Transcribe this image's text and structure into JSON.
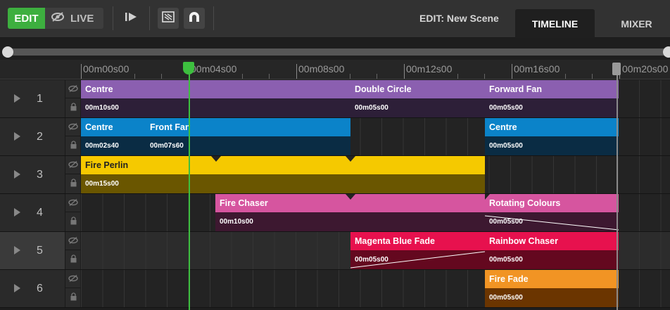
{
  "toolbar": {
    "edit_label": "EDIT",
    "live_label": "LIVE",
    "scene_label": "EDIT: New Scene",
    "tabs": {
      "timeline": "TIMELINE",
      "mixer": "MIXER"
    },
    "icons": [
      "hide-icon",
      "play-icon",
      "fill-frame-icon",
      "magnet-icon"
    ]
  },
  "ruler": {
    "labels": [
      "00m00s00",
      "00m04s00",
      "00m08s00",
      "00m12s00",
      "00m16s00",
      "00m20s00"
    ]
  },
  "tracks": [
    {
      "number": "1",
      "clips": [
        {
          "name": "Centre",
          "duration": "00m10s00",
          "color": "#8b5fb0"
        },
        {
          "name": "Double Circle",
          "duration": "00m05s00",
          "color": "#8b5fb0"
        },
        {
          "name": "Forward Fan",
          "duration": "00m05s00",
          "color": "#8b5fb0"
        }
      ]
    },
    {
      "number": "2",
      "clips": [
        {
          "name": "Centre",
          "duration": "00m02s40",
          "color": "#0b83c9"
        },
        {
          "name": "Front Fan",
          "duration": "00m07s60",
          "color": "#0b83c9"
        },
        {
          "name": "Centre",
          "duration": "00m05s00",
          "color": "#0b83c9"
        }
      ]
    },
    {
      "number": "3",
      "clips": [
        {
          "name": "Fire Perlin",
          "duration": "00m15s00",
          "color": "#f5c900"
        }
      ]
    },
    {
      "number": "4",
      "clips": [
        {
          "name": "Fire Chaser",
          "duration": "00m10s00",
          "color": "#d6559f"
        },
        {
          "name": "Rotating Colours",
          "duration": "00m05s00",
          "color": "#d6559f"
        }
      ]
    },
    {
      "number": "5",
      "clips": [
        {
          "name": "Magenta Blue Fade",
          "duration": "00m05s00",
          "color": "#e7114e"
        },
        {
          "name": "Rainbow Chaser",
          "duration": "00m05s00",
          "color": "#e7114e"
        }
      ]
    },
    {
      "number": "6",
      "clips": [
        {
          "name": "Fire Fade",
          "duration": "00m05s00",
          "color": "#f19424"
        }
      ]
    }
  ],
  "colors": {
    "accent": "#3daf3f",
    "playhead": "#3dbf3f"
  }
}
